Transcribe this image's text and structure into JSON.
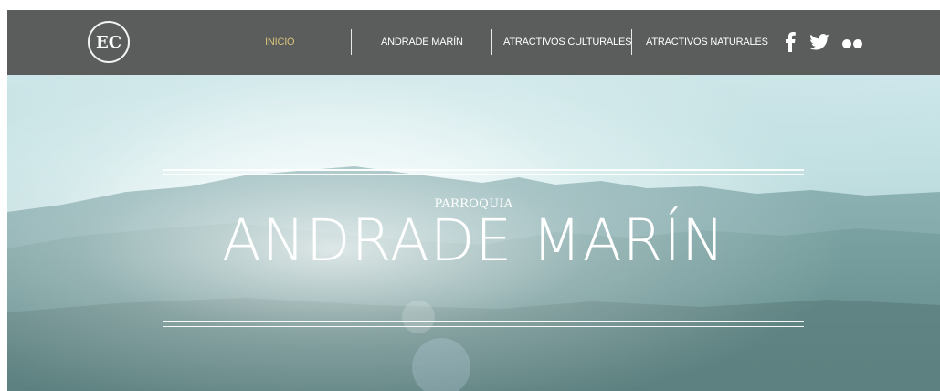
{
  "brand": {
    "logo_text": "EC"
  },
  "nav": {
    "items": [
      {
        "label": "INICIO"
      },
      {
        "label": "ANDRADE MARÍN"
      },
      {
        "label": "ATRACTIVOS CULTURALES"
      },
      {
        "label": "ATRACTIVOS NATURALES"
      }
    ],
    "social": [
      "facebook-icon",
      "twitter-icon",
      "flickr-icon"
    ]
  },
  "hero": {
    "subtitle": "PARROQUIA",
    "title": "ANDRADE MARÍN"
  },
  "colors": {
    "topbar": "#5a5d5c",
    "active_nav": "#d6c27a",
    "text": "#ffffff"
  }
}
